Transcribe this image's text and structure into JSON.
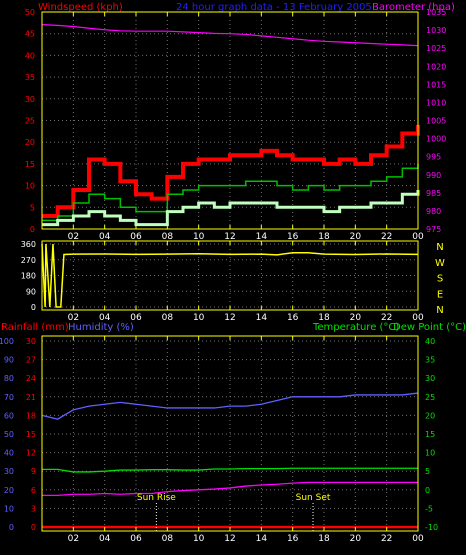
{
  "header": {
    "windspeed_label": "Windspeed (kph)",
    "graph_title": "24 hour graph data - 13 February 2005",
    "barometer_label": "Barometer (hpa)"
  },
  "lower_header": {
    "rainfall_label": "Rainfall (mm)",
    "humidity_label": "Humidity (%)",
    "temperature_label": "Temperature (°C)",
    "dewpoint_label": "Dew Point (°C)"
  },
  "annotations": {
    "sun_rise": "Sun Rise",
    "sun_set": "Sun Set"
  },
  "colors": {
    "wind_gust": "#ff0000",
    "wind_avg": "#00c000",
    "wind_min": "#c0ffc0",
    "barometer": "#ff00ff",
    "direction": "#ffff00",
    "humidity": "#6060ff",
    "temperature": "#ff00ff",
    "dew_point": "#00e000",
    "rainfall": "#ff0000",
    "frame": "#ffff00",
    "grid": "#707070"
  },
  "chart_data": [
    {
      "type": "line",
      "x_ticks": [
        "02",
        "04",
        "06",
        "08",
        "10",
        "12",
        "14",
        "16",
        "18",
        "20",
        "22",
        "00"
      ],
      "left_axis": {
        "ticks": [
          0,
          5,
          10,
          15,
          20,
          25,
          30,
          35,
          40,
          45,
          50
        ],
        "range": [
          0,
          50
        ],
        "label": "Windspeed (kph)"
      },
      "right_axis": {
        "ticks": [
          975,
          980,
          985,
          990,
          995,
          1000,
          1005,
          1010,
          1015,
          1020,
          1025,
          1030,
          1035
        ],
        "range": [
          975,
          1035
        ],
        "label": "Barometer (hpa)"
      },
      "hours": [
        0,
        1,
        2,
        3,
        4,
        5,
        6,
        7,
        8,
        9,
        10,
        11,
        12,
        13,
        14,
        15,
        16,
        17,
        18,
        19,
        20,
        21,
        22,
        23,
        24
      ],
      "series": [
        {
          "name": "gust",
          "axis": "left",
          "values": [
            3,
            5,
            9,
            16,
            15,
            11,
            8,
            7,
            12,
            15,
            16,
            16,
            17,
            17,
            18,
            17,
            16,
            16,
            15,
            16,
            15,
            17,
            19,
            22,
            24
          ]
        },
        {
          "name": "average",
          "axis": "left",
          "values": [
            2,
            3,
            6,
            8,
            7,
            5,
            4,
            4,
            8,
            9,
            10,
            10,
            10,
            11,
            11,
            10,
            9,
            10,
            9,
            10,
            10,
            11,
            12,
            14,
            15
          ]
        },
        {
          "name": "minimum",
          "axis": "left",
          "values": [
            1,
            2,
            3,
            4,
            3,
            2,
            1,
            1,
            4,
            5,
            6,
            5,
            6,
            6,
            6,
            5,
            5,
            5,
            4,
            5,
            5,
            6,
            6,
            8,
            9
          ]
        },
        {
          "name": "barometer",
          "axis": "right",
          "values": [
            1031.5,
            1031.3,
            1031,
            1030.5,
            1030.1,
            1029.8,
            1029.7,
            1029.7,
            1029.7,
            1029.5,
            1029.3,
            1029.1,
            1029,
            1028.8,
            1028.4,
            1028,
            1027.6,
            1027.2,
            1026.9,
            1026.7,
            1026.5,
            1026.3,
            1026.1,
            1025.9,
            1025.7
          ]
        }
      ]
    },
    {
      "type": "line",
      "x_ticks": [
        "02",
        "04",
        "06",
        "08",
        "10",
        "12",
        "14",
        "16",
        "18",
        "20",
        "22",
        "00"
      ],
      "left_axis": {
        "ticks": [
          0,
          90,
          180,
          270,
          360
        ],
        "range": [
          0,
          360
        ]
      },
      "right_axis": {
        "ticks": [
          "N",
          "W",
          "S",
          "E",
          "N"
        ]
      },
      "hours": [
        0,
        0.2,
        0.25,
        0.5,
        0.7,
        0.9,
        1,
        1.2,
        1.4,
        2,
        4,
        6,
        8,
        10,
        12,
        14,
        15,
        16,
        17,
        18,
        20,
        22,
        24
      ],
      "series": [
        {
          "name": "direction",
          "values": [
            360,
            0,
            360,
            0,
            360,
            0,
            0,
            0,
            300,
            302,
            303,
            301,
            302,
            304,
            301,
            302,
            298,
            310,
            310,
            302,
            300,
            303,
            301
          ]
        }
      ]
    },
    {
      "type": "line",
      "x_ticks": [
        "02",
        "04",
        "06",
        "08",
        "10",
        "12",
        "14",
        "16",
        "18",
        "20",
        "22",
        "00"
      ],
      "left_axis_rain": {
        "ticks": [
          0,
          3,
          6,
          9,
          12,
          15,
          18,
          21,
          24,
          27,
          30
        ],
        "range": [
          0,
          30
        ],
        "label": "Rainfall (mm)"
      },
      "left_axis_humidity": {
        "ticks": [
          0,
          10,
          20,
          30,
          40,
          50,
          60,
          70,
          80,
          90,
          100
        ],
        "range": [
          0,
          100
        ],
        "label": "Humidity (%)"
      },
      "right_axis": {
        "ticks": [
          -10,
          -5,
          0,
          5,
          10,
          15,
          20,
          25,
          30,
          35,
          40
        ],
        "range": [
          -10,
          40
        ],
        "label": "Temperature (°C)Dew Point (°C)"
      },
      "hours": [
        0,
        1,
        2,
        3,
        4,
        5,
        6,
        7,
        8,
        9,
        10,
        11,
        12,
        13,
        14,
        15,
        16,
        17,
        18,
        19,
        20,
        21,
        22,
        23,
        24
      ],
      "series": [
        {
          "name": "humidity",
          "values": [
            60,
            58,
            63,
            65,
            66,
            67,
            66,
            65,
            64,
            64,
            64,
            64,
            65,
            65,
            66,
            68,
            70,
            70,
            70,
            70,
            71,
            71,
            71,
            71,
            72
          ]
        },
        {
          "name": "temperature",
          "values": [
            -1.5,
            -1.5,
            -1.2,
            -1.2,
            -1,
            -1.2,
            -1,
            -1,
            -0.5,
            -0.2,
            0,
            0.2,
            0.5,
            1,
            1.3,
            1.5,
            1.8,
            2,
            2,
            2,
            2,
            2,
            2,
            2,
            2
          ]
        },
        {
          "name": "dew_point",
          "values": [
            5.5,
            5.5,
            4.8,
            4.8,
            5,
            5.3,
            5.3,
            5.4,
            5.4,
            5.3,
            5.3,
            5.6,
            5.6,
            5.7,
            5.7,
            5.7,
            5.8,
            5.8,
            5.8,
            5.8,
            5.8,
            5.8,
            5.8,
            5.8,
            5.8
          ]
        },
        {
          "name": "rainfall",
          "values": [
            0,
            0,
            0,
            0,
            0,
            0,
            0,
            0,
            0,
            0,
            0,
            0,
            0,
            0,
            0,
            0,
            0,
            0,
            0,
            0,
            0,
            0,
            0,
            0,
            0
          ]
        }
      ],
      "sun_rise_hour": 7.3,
      "sun_set_hour": 17.3
    }
  ]
}
